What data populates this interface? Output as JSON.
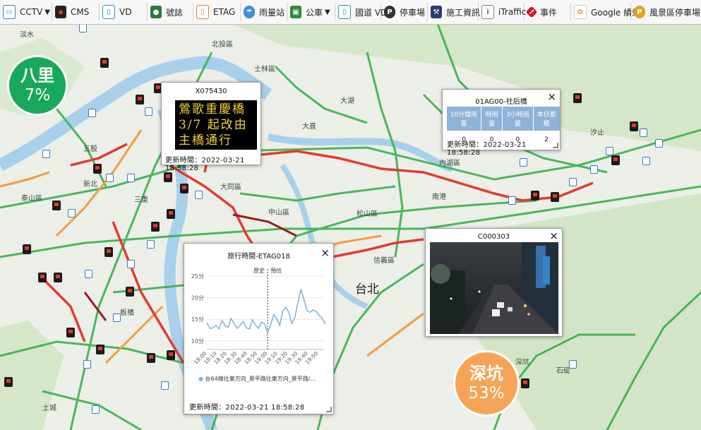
{
  "toolbar": {
    "items": [
      {
        "label": "CCTV",
        "icon": "cctv-icon",
        "caret": true
      },
      {
        "label": "CMS",
        "icon": "cms-icon",
        "caret": false
      },
      {
        "label": "VD",
        "icon": "vd-icon",
        "caret": false
      },
      {
        "label": "號誌",
        "icon": "traffic-signal-icon",
        "caret": false
      },
      {
        "label": "ETAG",
        "icon": "etag-icon",
        "caret": false
      },
      {
        "label": "雨量站",
        "icon": "rain-gauge-icon",
        "caret": false
      },
      {
        "label": "公車",
        "icon": "bus-icon",
        "caret": true
      },
      {
        "label": "國道 VD",
        "icon": "freeway-vd-icon",
        "caret": false
      },
      {
        "label": "停車場",
        "icon": "parking-icon",
        "caret": false
      },
      {
        "label": "施工資訊",
        "icon": "construction-icon",
        "caret": false
      },
      {
        "label": "iTraffic",
        "icon": "itraffic-icon",
        "caret": false
      },
      {
        "label": "事件",
        "icon": "incident-icon",
        "caret": false
      },
      {
        "label": "Google 績效",
        "icon": "google-performance-icon",
        "caret": false
      },
      {
        "label": "風景區停車場",
        "icon": "scenic-parking-icon",
        "caret": false
      }
    ]
  },
  "map": {
    "places": [
      "淡水",
      "北投區",
      "士林區",
      "內湖區",
      "大同區",
      "松山區",
      "台北",
      "五股",
      "泰山區",
      "新北",
      "信義區",
      "汐止",
      "深坑",
      "石碇",
      "大直",
      "大湖",
      "南港",
      "中山區",
      "板橋",
      "三重",
      "土城"
    ]
  },
  "occupancy": [
    {
      "name": "八里",
      "percent": "7%",
      "color": "#17a85a"
    },
    {
      "name": "深坑",
      "percent": "53%",
      "color": "#f5a457"
    }
  ],
  "popups": {
    "cms": {
      "title": "X075430",
      "lines": [
        "鶯歌重慶橋",
        "3/7 起改由",
        "主橋通行"
      ],
      "updated": "更新時間：2022-03-21 18:58:28"
    },
    "rain": {
      "title": "01AG00-社后橋",
      "headers": [
        "10分鐘雨量",
        "時雨量",
        "3小時雨量",
        "本日累積"
      ],
      "values": [
        "0",
        "0",
        "0",
        "2"
      ],
      "updated": "更新時間：2022-03-21 18:58:28"
    },
    "etag": {
      "title": "旅行時間-ETAG018",
      "legend": "台64線往東方向_景平路往東方向_景平路/...",
      "updated": "更新時間：2022-03-21 18:58:28"
    },
    "camera": {
      "title": "C000303"
    }
  },
  "chart_data": {
    "type": "line",
    "title": "旅行時間-ETAG018",
    "x": [
      "18:00",
      "18:10",
      "18:20",
      "18:30",
      "18:40",
      "18:50",
      "19:00",
      "19:10",
      "19:20",
      "19:30",
      "19:40",
      "19:50"
    ],
    "yticks": [
      "10分",
      "15分",
      "20分",
      "25分"
    ],
    "ylim": [
      8,
      26
    ],
    "annotations": [
      "歷史",
      "預估"
    ],
    "series": [
      {
        "name": "台64線往東方向_景平路往東方向_景平路/...",
        "x_minutes": [
          0,
          3,
          6,
          9,
          12,
          15,
          18,
          21,
          24,
          27,
          30,
          33,
          36,
          39,
          42,
          45,
          48,
          51,
          54,
          57,
          60,
          63,
          66,
          69,
          72,
          75,
          78,
          81,
          84,
          87,
          90,
          93,
          96,
          99,
          102,
          105,
          108,
          111,
          114,
          117
        ],
        "values": [
          14.2,
          12.9,
          13.0,
          13.6,
          12.8,
          14.7,
          13.6,
          13.1,
          15.2,
          14.0,
          12.9,
          13.6,
          14.5,
          13.0,
          12.8,
          14.9,
          13.7,
          12.9,
          14.4,
          13.9,
          11.8,
          13.8,
          16.1,
          15.2,
          13.6,
          17.0,
          17.8,
          16.6,
          14.0,
          15.5,
          19.0,
          22.0,
          19.5,
          17.0,
          16.6,
          17.2,
          16.8,
          15.9,
          15.2,
          13.9
        ]
      }
    ]
  }
}
